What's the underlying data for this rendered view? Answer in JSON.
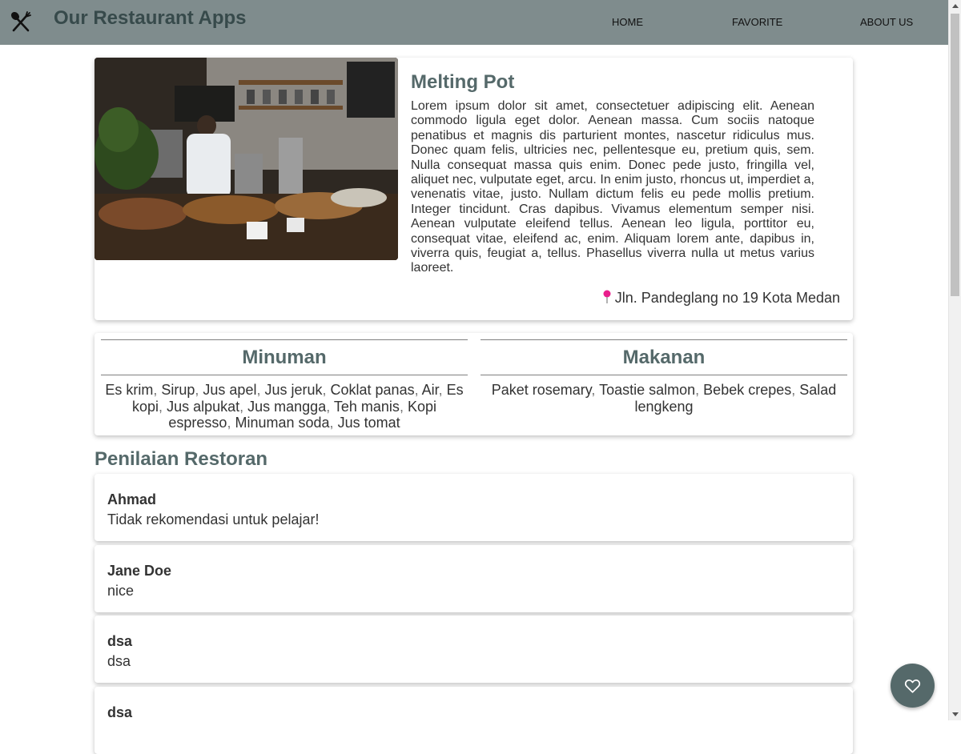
{
  "app": {
    "title": "Our Restaurant Apps",
    "logo_icon": "fork-knife-icon"
  },
  "nav": {
    "items": [
      {
        "label": "HOME"
      },
      {
        "label": "FAVORITE"
      },
      {
        "label": "ABOUT US"
      }
    ]
  },
  "restaurant": {
    "name": "Melting Pot",
    "image_alt": "Melting Pot",
    "description": "Lorem ipsum dolor sit amet, consectetuer adipiscing elit. Aenean commodo ligula eget dolor. Aenean massa. Cum sociis natoque penatibus et magnis dis parturient montes, nascetur ridiculus mus. Donec quam felis, ultricies nec, pellentesque eu, pretium quis, sem. Nulla consequat massa quis enim. Donec pede justo, fringilla vel, aliquet nec, vulputate eget, arcu. In enim justo, rhoncus ut, imperdiet a, venenatis vitae, justo. Nullam dictum felis eu pede mollis pretium. Integer tincidunt. Cras dapibus. Vivamus elementum semper nisi. Aenean vulputate eleifend tellus. Aenean leo ligula, porttitor eu, consequat vitae, eleifend ac, enim. Aliquam lorem ante, dapibus in, viverra quis, feugiat a, tellus. Phasellus viverra nulla ut metus varius laoreet.",
    "address": "Jln. Pandeglang no 19 Kota Medan",
    "address_icon": "pushpin-icon"
  },
  "menu": {
    "drinks": {
      "title": "Minuman",
      "items": [
        "Es krim",
        "Sirup",
        "Jus apel",
        "Jus jeruk",
        "Coklat panas",
        "Air",
        "Es kopi",
        "Jus alpukat",
        "Jus mangga",
        "Teh manis",
        "Kopi espresso",
        "Minuman soda",
        "Jus tomat"
      ]
    },
    "foods": {
      "title": "Makanan",
      "items": [
        "Paket rosemary",
        "Toastie salmon",
        "Bebek crepes",
        "Salad lengkeng"
      ]
    }
  },
  "reviews": {
    "heading": "Penilaian Restoran",
    "items": [
      {
        "name": "Ahmad",
        "review": "Tidak rekomendasi untuk pelajar!"
      },
      {
        "name": "Jane Doe",
        "review": "nice"
      },
      {
        "name": "dsa",
        "review": "dsa"
      },
      {
        "name": "dsa",
        "review": ""
      }
    ]
  },
  "favorite_button": {
    "icon": "heart-outline-icon"
  },
  "colors": {
    "header_bg": "#7f8c8d",
    "accent": "#55696a",
    "pin": "#e91e8c"
  }
}
